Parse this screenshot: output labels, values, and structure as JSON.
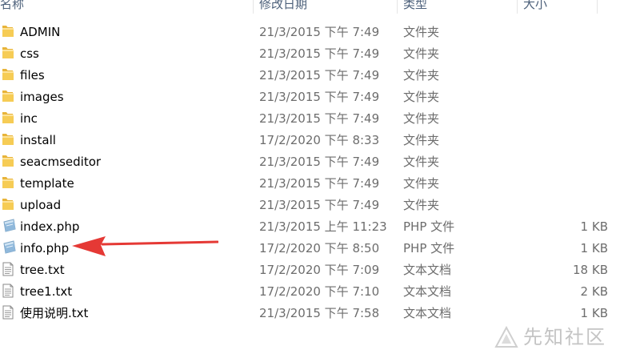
{
  "columns": {
    "name": "名称",
    "date": "修改日期",
    "type": "类型",
    "size": "大小"
  },
  "files": [
    {
      "name": "ADMIN",
      "date": "21/3/2015 下午 7:49",
      "type": "文件夹",
      "size": "",
      "icon": "folder-icon"
    },
    {
      "name": "css",
      "date": "21/3/2015 下午 7:49",
      "type": "文件夹",
      "size": "",
      "icon": "folder-icon"
    },
    {
      "name": "files",
      "date": "21/3/2015 下午 7:49",
      "type": "文件夹",
      "size": "",
      "icon": "folder-icon"
    },
    {
      "name": "images",
      "date": "21/3/2015 下午 7:49",
      "type": "文件夹",
      "size": "",
      "icon": "folder-icon"
    },
    {
      "name": "inc",
      "date": "21/3/2015 下午 7:49",
      "type": "文件夹",
      "size": "",
      "icon": "folder-icon"
    },
    {
      "name": "install",
      "date": "17/2/2020 下午 8:33",
      "type": "文件夹",
      "size": "",
      "icon": "folder-icon"
    },
    {
      "name": "seacmseditor",
      "date": "21/3/2015 下午 7:49",
      "type": "文件夹",
      "size": "",
      "icon": "folder-icon"
    },
    {
      "name": "template",
      "date": "21/3/2015 下午 7:49",
      "type": "文件夹",
      "size": "",
      "icon": "folder-icon"
    },
    {
      "name": "upload",
      "date": "21/3/2015 下午 7:49",
      "type": "文件夹",
      "size": "",
      "icon": "folder-icon"
    },
    {
      "name": "index.php",
      "date": "21/3/2015 上午 11:23",
      "type": "PHP 文件",
      "size": "1 KB",
      "icon": "php-file-icon"
    },
    {
      "name": "info.php",
      "date": "17/2/2020 下午 8:50",
      "type": "PHP 文件",
      "size": "1 KB",
      "icon": "php-file-icon"
    },
    {
      "name": "tree.txt",
      "date": "17/2/2020 下午 7:09",
      "type": "文本文档",
      "size": "18 KB",
      "icon": "text-file-icon"
    },
    {
      "name": "tree1.txt",
      "date": "17/2/2020 下午 7:10",
      "type": "文本文档",
      "size": "2 KB",
      "icon": "text-file-icon"
    },
    {
      "name": "使用说明.txt",
      "date": "21/3/2015 下午 7:58",
      "type": "文本文档",
      "size": "1 KB",
      "icon": "text-file-icon"
    }
  ],
  "annotation": {
    "arrow_color": "#e53935",
    "points_to": "info.php"
  },
  "watermark": {
    "text": "先知社区"
  }
}
